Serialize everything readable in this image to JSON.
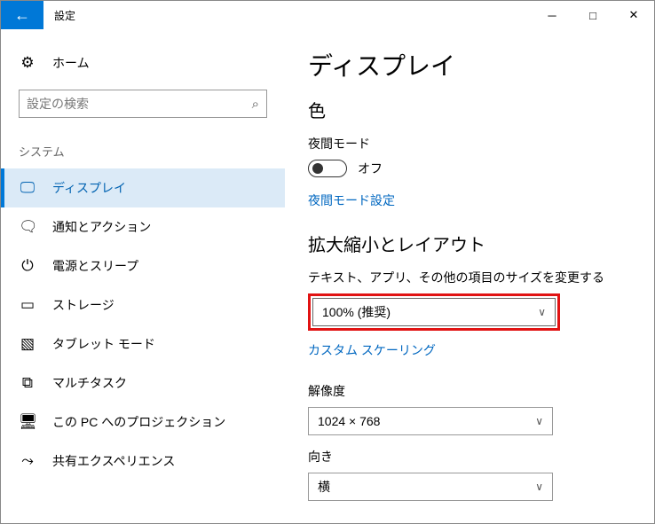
{
  "titlebar": {
    "title": "設定"
  },
  "sidebar": {
    "home_label": "ホーム",
    "search_placeholder": "設定の検索",
    "group_label": "システム",
    "items": [
      {
        "label": "ディスプレイ"
      },
      {
        "label": "通知とアクション"
      },
      {
        "label": "電源とスリープ"
      },
      {
        "label": "ストレージ"
      },
      {
        "label": "タブレット モード"
      },
      {
        "label": "マルチタスク"
      },
      {
        "label": "この PC へのプロジェクション"
      },
      {
        "label": "共有エクスペリエンス"
      }
    ]
  },
  "main": {
    "page_title": "ディスプレイ",
    "color_heading": "色",
    "night_light_label": "夜間モード",
    "night_light_state": "オフ",
    "night_light_link": "夜間モード設定",
    "scale_heading": "拡大縮小とレイアウト",
    "scale_label": "テキスト、アプリ、その他の項目のサイズを変更する",
    "scale_value": "100% (推奨)",
    "custom_scaling_link": "カスタム スケーリング",
    "resolution_label": "解像度",
    "resolution_value": "1024 × 768",
    "orientation_label": "向き",
    "orientation_value": "横"
  }
}
